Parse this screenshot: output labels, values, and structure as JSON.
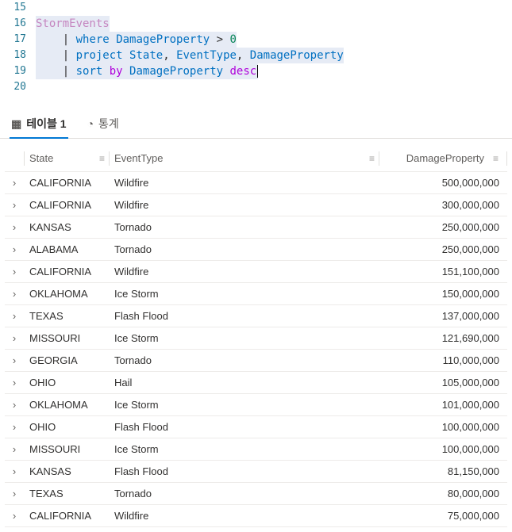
{
  "editor": {
    "lines": [
      {
        "num": "15",
        "tokens": []
      },
      {
        "num": "16",
        "hl": true,
        "tokens": [
          {
            "t": "StormEvents",
            "c": "kw-table"
          }
        ]
      },
      {
        "num": "17",
        "hl": true,
        "tokens": [
          {
            "t": "    ",
            "c": ""
          },
          {
            "t": "|",
            "c": "kw-pipe"
          },
          {
            "t": " ",
            "c": ""
          },
          {
            "t": "where",
            "c": "kw-op"
          },
          {
            "t": " ",
            "c": ""
          },
          {
            "t": "DamageProperty",
            "c": "kw-ident"
          },
          {
            "t": " > ",
            "c": "kw-punc"
          },
          {
            "t": "0",
            "c": "kw-num"
          }
        ]
      },
      {
        "num": "18",
        "hl": true,
        "tokens": [
          {
            "t": "    ",
            "c": ""
          },
          {
            "t": "|",
            "c": "kw-pipe"
          },
          {
            "t": " ",
            "c": ""
          },
          {
            "t": "project",
            "c": "kw-op"
          },
          {
            "t": " ",
            "c": ""
          },
          {
            "t": "State",
            "c": "kw-ident"
          },
          {
            "t": ", ",
            "c": "kw-punc"
          },
          {
            "t": "EventType",
            "c": "kw-ident"
          },
          {
            "t": ", ",
            "c": "kw-punc"
          },
          {
            "t": "DamageProperty",
            "c": "kw-ident"
          }
        ]
      },
      {
        "num": "19",
        "hl": true,
        "cursor": true,
        "tokens": [
          {
            "t": "    ",
            "c": ""
          },
          {
            "t": "|",
            "c": "kw-pipe"
          },
          {
            "t": " ",
            "c": ""
          },
          {
            "t": "sort",
            "c": "kw-op"
          },
          {
            "t": " ",
            "c": ""
          },
          {
            "t": "by",
            "c": "kw-sort"
          },
          {
            "t": " ",
            "c": ""
          },
          {
            "t": "DamageProperty",
            "c": "kw-ident"
          },
          {
            "t": " ",
            "c": ""
          },
          {
            "t": "desc",
            "c": "kw-sort"
          }
        ]
      },
      {
        "num": "20",
        "tokens": []
      }
    ]
  },
  "tabs": {
    "table_icon": "▦",
    "table_label": "테이블 1",
    "stats_icon": "◔",
    "stats_label": "통계"
  },
  "columns": {
    "state": "State",
    "event": "EventType",
    "damage": "DamageProperty",
    "menu_glyph": "≡"
  },
  "rows": [
    {
      "state": "CALIFORNIA",
      "event": "Wildfire",
      "damage": "500,000,000"
    },
    {
      "state": "CALIFORNIA",
      "event": "Wildfire",
      "damage": "300,000,000"
    },
    {
      "state": "KANSAS",
      "event": "Tornado",
      "damage": "250,000,000"
    },
    {
      "state": "ALABAMA",
      "event": "Tornado",
      "damage": "250,000,000"
    },
    {
      "state": "CALIFORNIA",
      "event": "Wildfire",
      "damage": "151,100,000"
    },
    {
      "state": "OKLAHOMA",
      "event": "Ice Storm",
      "damage": "150,000,000"
    },
    {
      "state": "TEXAS",
      "event": "Flash Flood",
      "damage": "137,000,000"
    },
    {
      "state": "MISSOURI",
      "event": "Ice Storm",
      "damage": "121,690,000"
    },
    {
      "state": "GEORGIA",
      "event": "Tornado",
      "damage": "110,000,000"
    },
    {
      "state": "OHIO",
      "event": "Hail",
      "damage": "105,000,000"
    },
    {
      "state": "OKLAHOMA",
      "event": "Ice Storm",
      "damage": "101,000,000"
    },
    {
      "state": "OHIO",
      "event": "Flash Flood",
      "damage": "100,000,000"
    },
    {
      "state": "MISSOURI",
      "event": "Ice Storm",
      "damage": "100,000,000"
    },
    {
      "state": "KANSAS",
      "event": "Flash Flood",
      "damage": "81,150,000"
    },
    {
      "state": "TEXAS",
      "event": "Tornado",
      "damage": "80,000,000"
    },
    {
      "state": "CALIFORNIA",
      "event": "Wildfire",
      "damage": "75,000,000"
    }
  ],
  "expand_glyph": "›"
}
